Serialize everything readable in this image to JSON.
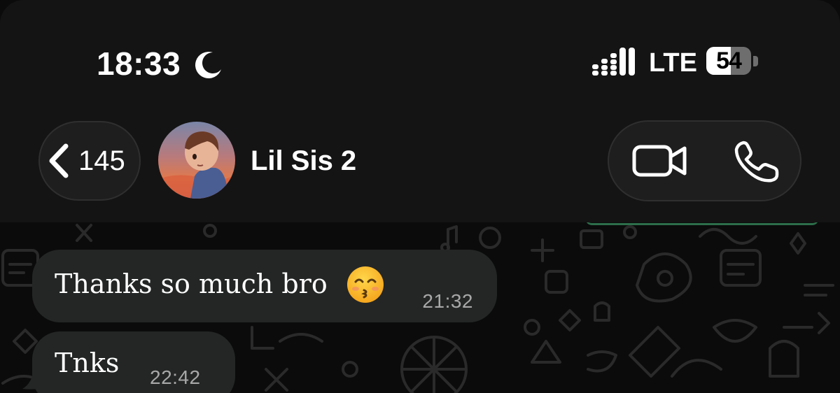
{
  "status_bar": {
    "time": "18:33",
    "focus_icon": "moon-icon",
    "signal_icon": "signal-bars-icon",
    "network": "LTE",
    "battery_percent": "54",
    "battery_level": 0.54
  },
  "header": {
    "back_icon": "chevron-left-icon",
    "back_count": "145",
    "avatar_icon": "contact-avatar",
    "contact_name": "Lil Sis 2",
    "video_call_icon": "video-camera-icon",
    "voice_call_icon": "phone-icon"
  },
  "messages": [
    {
      "direction": "incoming",
      "text": "Thanks so much bro",
      "emoji": "kissing-face-with-smiling-eyes",
      "time": "21:32"
    },
    {
      "direction": "incoming",
      "text": "Tnks",
      "time": "22:42"
    }
  ],
  "colors": {
    "header_bg": "#141414",
    "chat_bg": "#0b0b0b",
    "bubble_bg": "#242626",
    "timestamp": "#a8a8a8",
    "accent_green": "#2c6e4a"
  }
}
